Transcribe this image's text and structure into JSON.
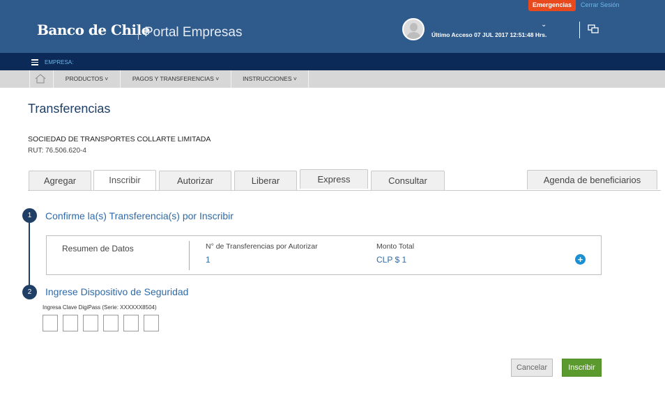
{
  "header": {
    "emergency_label": "Emergencias",
    "logout_label": "Cerrar Sesión",
    "brand": "Banco de Chile",
    "portal": "Portal Empresas",
    "last_access": "Último Acceso 07 JUL 2017 12:51:48 Hrs."
  },
  "navbar": {
    "empresa_label": "EMPRESA:"
  },
  "menu": [
    {
      "label": "PRODUCTOS ˅"
    },
    {
      "label": "PAGOS Y TRANSFERENCIAS ˅"
    },
    {
      "label": "INSTRUCCIONES ˅"
    }
  ],
  "page": {
    "title": "Transferencias",
    "company": "SOCIEDAD DE TRANSPORTES COLLARTE LIMITADA",
    "rut": "RUT: 76.506.620-4"
  },
  "tabs": [
    {
      "label": "Agregar"
    },
    {
      "label": "Inscribir"
    },
    {
      "label": "Autorizar"
    },
    {
      "label": "Liberar"
    },
    {
      "label": "Express"
    },
    {
      "label": "Consultar"
    },
    {
      "label": "Agenda de beneficiarios"
    }
  ],
  "steps": [
    {
      "number": "1",
      "title": "Confirme la(s) Transferencia(s) por Inscribir"
    },
    {
      "number": "2",
      "title": "Ingrese Dispositivo de Seguridad"
    }
  ],
  "summary": {
    "label": "Resumen de Datos",
    "col1_header": "N° de Transferencias por Autorizar",
    "col1_value": "1",
    "col2_header": "Monto Total",
    "col2_value": "CLP $ 1",
    "expand_icon": "plus-icon"
  },
  "security": {
    "label": "Ingresa Clave DigiPass (Serie: XXXXXX8504)"
  },
  "actions": {
    "cancel_label": "Cancelar",
    "submit_label": "Inscribir"
  },
  "colors": {
    "header": "#2f5a8c",
    "navbar": "#0b2a57",
    "accent": "#2f6aa8",
    "emergency": "#e8491d",
    "submit": "#5b9a2e"
  }
}
